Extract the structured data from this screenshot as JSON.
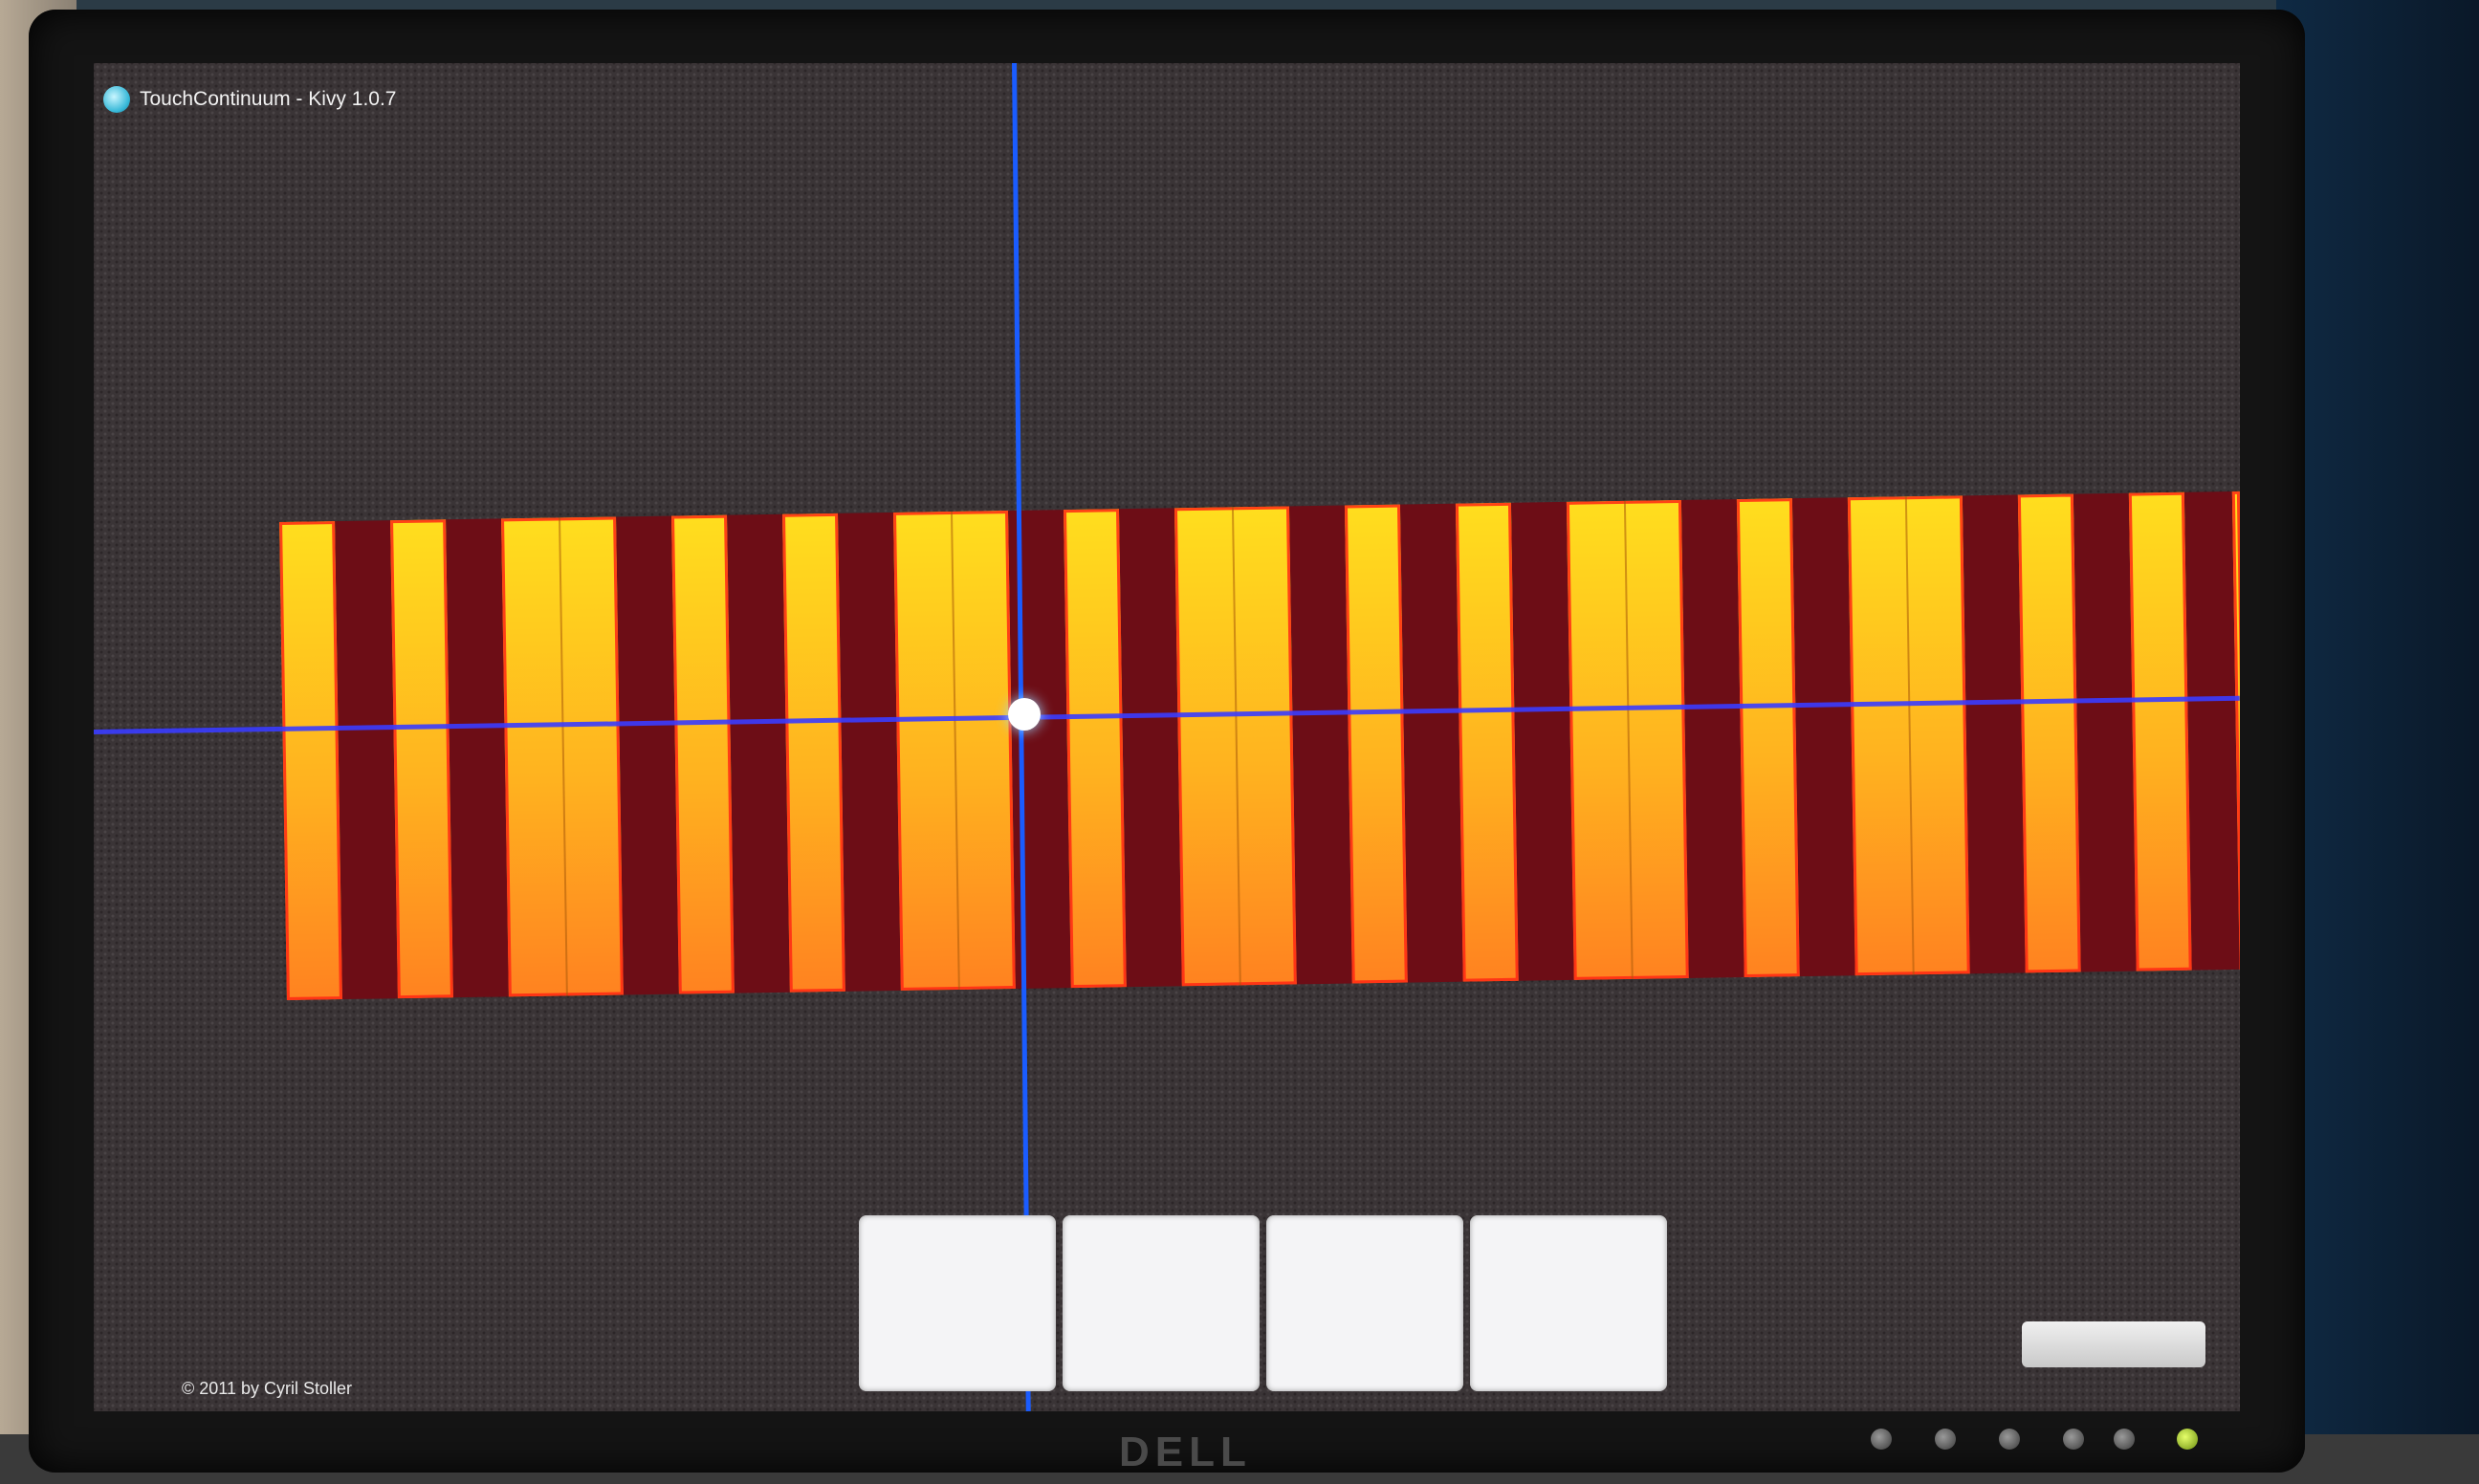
{
  "window": {
    "title": "TouchContinuum - Kivy 1.0.7"
  },
  "app": {
    "copyright": "© 2011 by Cyril Stoller",
    "mode_buttons": [
      "",
      "",
      "",
      ""
    ],
    "settings_button_label": ""
  },
  "keyboard": {
    "key_pattern": [
      "single",
      "single",
      "double",
      "single",
      "single",
      "double",
      "single",
      "double",
      "single",
      "single",
      "double",
      "single",
      "double",
      "single",
      "single"
    ],
    "colors": {
      "key_top": "#ffde1e",
      "key_bottom": "#ff8220",
      "key_border": "#ff2814",
      "gap": "#6d0d16",
      "crosshair": "#1a5cff"
    }
  },
  "monitor": {
    "brand": "DELL"
  }
}
